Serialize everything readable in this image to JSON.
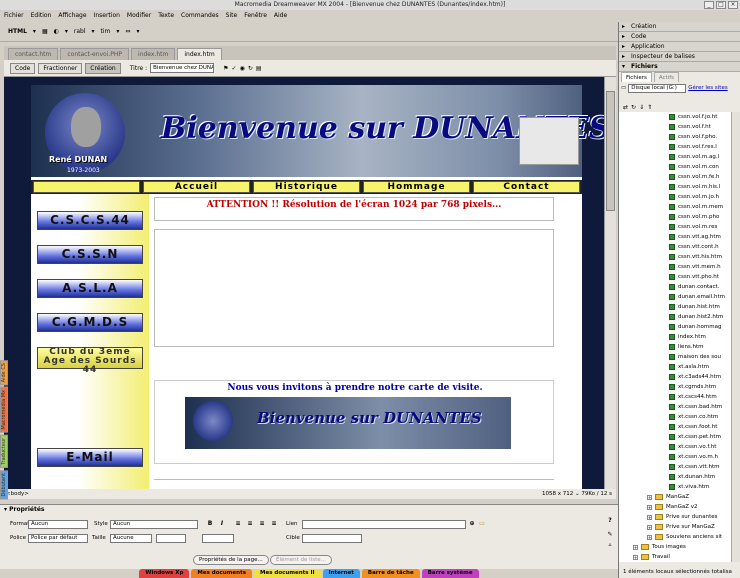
{
  "app": {
    "title": "Macromedia Dreamweaver MX 2004 - [Bienvenue chez DUNANTES (Dunantes/index.htm)]"
  },
  "menu": [
    "Fichier",
    "Edition",
    "Affichage",
    "Insertion",
    "Modifier",
    "Texte",
    "Commandes",
    "Site",
    "Fenêtre",
    "Aide"
  ],
  "insertbar": {
    "group": "HTML",
    "items": [
      "▾",
      "▦",
      "◐",
      "▾",
      "rabl",
      "▾",
      "tim",
      "▾",
      "⇔",
      "▾"
    ]
  },
  "doctabs": [
    "contact.htm",
    "contact-envoi.PHP",
    "index.htm",
    "index.htm"
  ],
  "doctoolbar": {
    "views": [
      "Code",
      "Fractionner",
      "Création"
    ],
    "title_label": "Titre :",
    "title_value": "Bienvenue chez DUNANTES"
  },
  "page": {
    "banner_title": "Bienvenue sur DUNANTES",
    "banner_caption1": "René DUNAN",
    "banner_caption2": "1973-2003",
    "nav": [
      "",
      "Accueil",
      "Historique",
      "Hommage",
      "Contact"
    ],
    "left_buttons": [
      "C.S.C.S.44",
      "C.S.S.N",
      "A.S.L.A",
      "C.G.M.D.S",
      "Club du 3eme Age des Sourds 44",
      "E-Mail"
    ],
    "attention": "ATTENTION !! Résolution de l'écran 1024 par 768 pixels...",
    "invite": "Nous vous invitons à prendre notre carte de visite.",
    "card_title": "Bienvenue sur DUNANTES"
  },
  "statusbar": {
    "tag": "<body>",
    "info": "1058 x 712 ⌄ 79Ko / 12 s"
  },
  "side_tabs": [
    "Aide CS",
    "Macromedia Mx",
    "Traducteur",
    "Débutant"
  ],
  "properties": {
    "title": "Propriétés",
    "format_label": "Format",
    "format_value": "Aucun",
    "style_label": "Style",
    "style_value": "Aucun",
    "lien_label": "Lien",
    "police_label": "Police",
    "police_value": "Police par défaut",
    "taille_label": "Taille",
    "taille_value": "Aucune",
    "cible_label": "Cible",
    "page_button": "Propriétés de la page...",
    "list_button": "Élément de liste..."
  },
  "taskbar": [
    {
      "label": "Windows Xp",
      "color": "#e04040"
    },
    {
      "label": "Mes documents",
      "color": "#f08020"
    },
    {
      "label": "Mes documents II",
      "color": "#f0e040"
    },
    {
      "label": "Internet",
      "color": "#40a0f0"
    },
    {
      "label": "Barre de tâche",
      "color": "#f09020"
    },
    {
      "label": "Barre système",
      "color": "#c040c0"
    }
  ],
  "right_panel": {
    "sections": [
      "Création",
      "Code",
      "Application",
      "Inspecteur de balises",
      "Fichiers"
    ],
    "file_tabs": [
      "Fichiers",
      "Actifs"
    ],
    "disk": "Disque local (G:)",
    "disk_link": "Gérer les sites",
    "files": [
      "cssn.vol.f.jo.ht",
      "cssn.vol.f.ht",
      "cssn.vol.f.pho.",
      "cssn.vol.f.res.l",
      "cssn.vol.m.ag.l",
      "cssn.vol.m.con",
      "cssn.vol.m.fe.h",
      "cssn.vol.m.his.l",
      "cssn.vol.m.jo.h",
      "cssn.vol.m.mem",
      "cssn.vol.m.pho",
      "cssn.vol.m.res",
      "cssn.vtt.ag.htm",
      "cssn.vtt.cont.h",
      "cssn.vtt.his.htm",
      "cssn.vtt.mem.h",
      "cssn.vtt.pho.ht",
      "dunan.contact.",
      "dunan.email.htm",
      "dunan.hist.htm",
      "dunan.hist2.htm",
      "dunan.hommag",
      "index.htm",
      "liens.htm",
      "maison des sou",
      "xt.asla.htm",
      "xt.c3ads44.htm",
      "xt.cgmds.htm",
      "xt.cscs44.htm",
      "xt.cssn.bad.htm",
      "xt.cssn.co.htm",
      "xt.cssn.foot.ht",
      "xt.cssn.pet.htm",
      "xt.cssn.vo.f.ht",
      "xt.cssn.vo.m.h",
      "xt.cssn.vtt.htm",
      "xt.dunan.htm",
      "xt.viva.htm"
    ],
    "folders": [
      "ManGaZ",
      "ManGaZ v2",
      "Prive sur dunantes",
      "Prive sur ManGaZ",
      "Souviens anciens sit",
      "Tous images",
      "Travail"
    ],
    "status": "1 éléments locaux sélectionnés totalisa"
  },
  "colors": {
    "canvas_bg": "#0f1a3a",
    "nav_yellow": "#f7f36a",
    "attention_red": "#c00000",
    "invite_blue": "#0000a0",
    "link_blue": "#0000c0"
  }
}
